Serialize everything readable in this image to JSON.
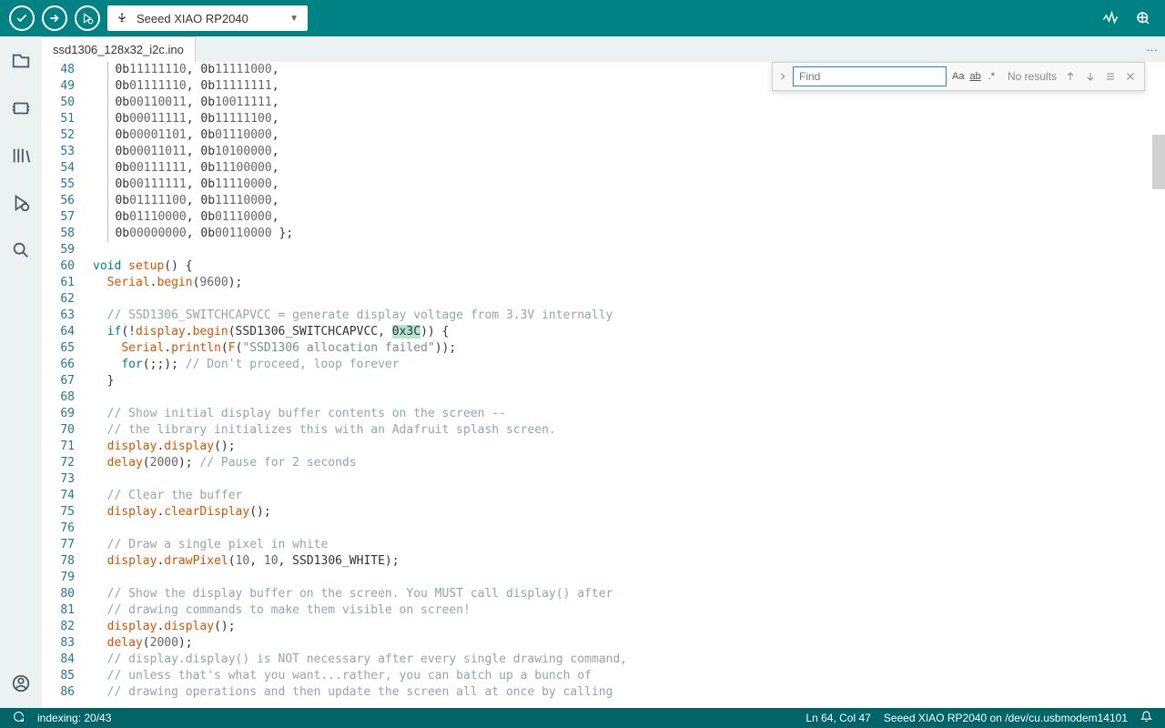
{
  "toolbar": {
    "board_name": "Seeed XIAO RP2040"
  },
  "tabs": {
    "file_tab": "ssd1306_128x32_i2c.ino"
  },
  "find": {
    "placeholder": "Find",
    "results": "No results"
  },
  "status": {
    "indexing": "indexing: 20/43",
    "cursor": "Ln 64, Col 47",
    "board_port": "Seeed XIAO RP2040 on /dev/cu.usbmodem14101"
  },
  "code": {
    "first_line": 48,
    "highlight_line": 64,
    "highlight_text": "0x3C",
    "lines": [
      [
        [
          "p",
          "  "
        ],
        [
          "g",
          ""
        ],
        [
          "p",
          "0b"
        ],
        [
          "n",
          "11111110"
        ],
        [
          "p",
          ", 0b"
        ],
        [
          "n",
          "11111000"
        ],
        [
          "p",
          ","
        ]
      ],
      [
        [
          "p",
          "  "
        ],
        [
          "g",
          ""
        ],
        [
          "p",
          "0b"
        ],
        [
          "n",
          "01111110"
        ],
        [
          "p",
          ", 0b"
        ],
        [
          "n",
          "11111111"
        ],
        [
          "p",
          ","
        ]
      ],
      [
        [
          "p",
          "  "
        ],
        [
          "g",
          ""
        ],
        [
          "p",
          "0b"
        ],
        [
          "n",
          "00110011"
        ],
        [
          "p",
          ", 0b"
        ],
        [
          "n",
          "10011111"
        ],
        [
          "p",
          ","
        ]
      ],
      [
        [
          "p",
          "  "
        ],
        [
          "g",
          ""
        ],
        [
          "p",
          "0b"
        ],
        [
          "n",
          "00011111"
        ],
        [
          "p",
          ", 0b"
        ],
        [
          "n",
          "11111100"
        ],
        [
          "p",
          ","
        ]
      ],
      [
        [
          "p",
          "  "
        ],
        [
          "g",
          ""
        ],
        [
          "p",
          "0b"
        ],
        [
          "n",
          "00001101"
        ],
        [
          "p",
          ", 0b"
        ],
        [
          "n",
          "01110000"
        ],
        [
          "p",
          ","
        ]
      ],
      [
        [
          "p",
          "  "
        ],
        [
          "g",
          ""
        ],
        [
          "p",
          "0b"
        ],
        [
          "n",
          "00011011"
        ],
        [
          "p",
          ", 0b"
        ],
        [
          "n",
          "10100000"
        ],
        [
          "p",
          ","
        ]
      ],
      [
        [
          "p",
          "  "
        ],
        [
          "g",
          ""
        ],
        [
          "p",
          "0b"
        ],
        [
          "n",
          "00111111"
        ],
        [
          "p",
          ", 0b"
        ],
        [
          "n",
          "11100000"
        ],
        [
          "p",
          ","
        ]
      ],
      [
        [
          "p",
          "  "
        ],
        [
          "g",
          ""
        ],
        [
          "p",
          "0b"
        ],
        [
          "n",
          "00111111"
        ],
        [
          "p",
          ", 0b"
        ],
        [
          "n",
          "11110000"
        ],
        [
          "p",
          ","
        ]
      ],
      [
        [
          "p",
          "  "
        ],
        [
          "g",
          ""
        ],
        [
          "p",
          "0b"
        ],
        [
          "n",
          "01111100"
        ],
        [
          "p",
          ", 0b"
        ],
        [
          "n",
          "11110000"
        ],
        [
          "p",
          ","
        ]
      ],
      [
        [
          "p",
          "  "
        ],
        [
          "g",
          ""
        ],
        [
          "p",
          "0b"
        ],
        [
          "n",
          "01110000"
        ],
        [
          "p",
          ", 0b"
        ],
        [
          "n",
          "01110000"
        ],
        [
          "p",
          ","
        ]
      ],
      [
        [
          "p",
          "  "
        ],
        [
          "g",
          ""
        ],
        [
          "p",
          "0b"
        ],
        [
          "n",
          "00000000"
        ],
        [
          "p",
          ", 0b"
        ],
        [
          "n",
          "00110000"
        ],
        [
          "p",
          " };"
        ]
      ],
      [],
      [
        [
          "k",
          "void"
        ],
        [
          "p",
          " "
        ],
        [
          "f",
          "setup"
        ],
        [
          "p",
          "() {"
        ]
      ],
      [
        [
          "p",
          "  "
        ],
        [
          "f",
          "Serial"
        ],
        [
          "p",
          "."
        ],
        [
          "f",
          "begin"
        ],
        [
          "p",
          "("
        ],
        [
          "n",
          "9600"
        ],
        [
          "p",
          ");"
        ]
      ],
      [],
      [
        [
          "p",
          "  "
        ],
        [
          "c",
          "// SSD1306_SWITCHCAPVCC = generate display voltage from 3.3V internally"
        ]
      ],
      [
        [
          "p",
          "  "
        ],
        [
          "k",
          "if"
        ],
        [
          "p",
          "(!"
        ],
        [
          "f",
          "display"
        ],
        [
          "p",
          "."
        ],
        [
          "f",
          "begin"
        ],
        [
          "p",
          "(SSD1306_SWITCHCAPVCC, "
        ],
        [
          "hl",
          "0x3C"
        ],
        [
          "p",
          ")) {"
        ]
      ],
      [
        [
          "p",
          "    "
        ],
        [
          "f",
          "Serial"
        ],
        [
          "p",
          "."
        ],
        [
          "f",
          "println"
        ],
        [
          "p",
          "("
        ],
        [
          "f",
          "F"
        ],
        [
          "p",
          "("
        ],
        [
          "s",
          "\"SSD1306 allocation failed\""
        ],
        [
          "p",
          "));"
        ]
      ],
      [
        [
          "p",
          "    "
        ],
        [
          "k",
          "for"
        ],
        [
          "p",
          "(;;); "
        ],
        [
          "c",
          "// Don't proceed, loop forever"
        ]
      ],
      [
        [
          "p",
          "  }"
        ]
      ],
      [],
      [
        [
          "p",
          "  "
        ],
        [
          "c",
          "// Show initial display buffer contents on the screen --"
        ]
      ],
      [
        [
          "p",
          "  "
        ],
        [
          "c",
          "// the library initializes this with an Adafruit splash screen."
        ]
      ],
      [
        [
          "p",
          "  "
        ],
        [
          "f",
          "display"
        ],
        [
          "p",
          "."
        ],
        [
          "f",
          "display"
        ],
        [
          "p",
          "();"
        ]
      ],
      [
        [
          "p",
          "  "
        ],
        [
          "f",
          "delay"
        ],
        [
          "p",
          "("
        ],
        [
          "n",
          "2000"
        ],
        [
          "p",
          "); "
        ],
        [
          "c",
          "// Pause for 2 seconds"
        ]
      ],
      [],
      [
        [
          "p",
          "  "
        ],
        [
          "c",
          "// Clear the buffer"
        ]
      ],
      [
        [
          "p",
          "  "
        ],
        [
          "f",
          "display"
        ],
        [
          "p",
          "."
        ],
        [
          "f",
          "clearDisplay"
        ],
        [
          "p",
          "();"
        ]
      ],
      [],
      [
        [
          "p",
          "  "
        ],
        [
          "c",
          "// Draw a single pixel in white"
        ]
      ],
      [
        [
          "p",
          "  "
        ],
        [
          "f",
          "display"
        ],
        [
          "p",
          "."
        ],
        [
          "f",
          "drawPixel"
        ],
        [
          "p",
          "("
        ],
        [
          "n",
          "10"
        ],
        [
          "p",
          ", "
        ],
        [
          "n",
          "10"
        ],
        [
          "p",
          ", SSD1306_WHITE);"
        ]
      ],
      [],
      [
        [
          "p",
          "  "
        ],
        [
          "c",
          "// Show the display buffer on the screen. You MUST call display() after"
        ]
      ],
      [
        [
          "p",
          "  "
        ],
        [
          "c",
          "// drawing commands to make them visible on screen!"
        ]
      ],
      [
        [
          "p",
          "  "
        ],
        [
          "f",
          "display"
        ],
        [
          "p",
          "."
        ],
        [
          "f",
          "display"
        ],
        [
          "p",
          "();"
        ]
      ],
      [
        [
          "p",
          "  "
        ],
        [
          "f",
          "delay"
        ],
        [
          "p",
          "("
        ],
        [
          "n",
          "2000"
        ],
        [
          "p",
          ");"
        ]
      ],
      [
        [
          "p",
          "  "
        ],
        [
          "c",
          "// display.display() is NOT necessary after every single drawing command,"
        ]
      ],
      [
        [
          "p",
          "  "
        ],
        [
          "c",
          "// unless that's what you want...rather, you can batch up a bunch of"
        ]
      ],
      [
        [
          "p",
          "  "
        ],
        [
          "c",
          "// drawing operations and then update the screen all at once by calling"
        ]
      ]
    ]
  }
}
